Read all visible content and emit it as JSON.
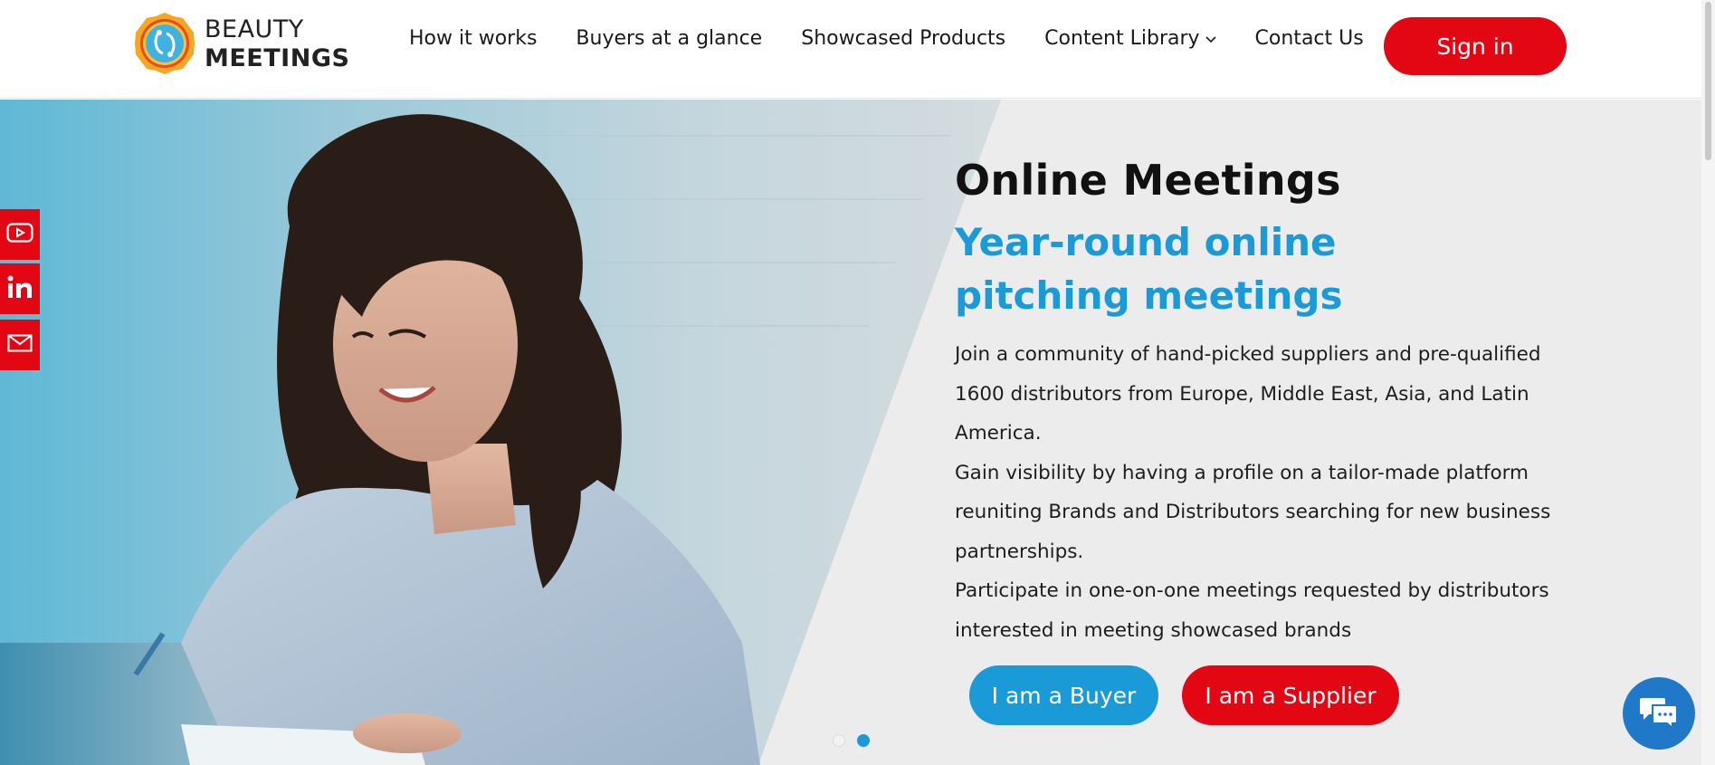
{
  "brand": {
    "line1": "BEAUTY",
    "line2": "MEETINGS"
  },
  "nav": {
    "items": [
      {
        "label": "How it works"
      },
      {
        "label": "Buyers at a glance"
      },
      {
        "label": "Showcased Products"
      },
      {
        "label": "Content Library",
        "icon": "chevron-down-icon"
      },
      {
        "label": "Contact Us"
      }
    ],
    "signin_label": "Sign in"
  },
  "hero": {
    "title": "Online Meetings",
    "subtitle": "Year-round online pitching meetings",
    "paragraphs": [
      "Join a community of hand-picked suppliers and pre-qualified 1600 distributors from Europe, Middle East, Asia, and Latin America.",
      "Gain visibility by having a profile on a tailor-made platform reuniting Brands and Distributors searching for new business partnerships.",
      "Participate in one-on-one meetings requested by distributors interested in meeting showcased brands"
    ],
    "buyer_label": "I am a Buyer",
    "supplier_label": "I am a Supplier",
    "slides": {
      "count": 2,
      "active": 2
    }
  },
  "social": [
    "youtube-icon",
    "linkedin-icon",
    "email-icon"
  ],
  "chat": {
    "icon": "chat-icon"
  },
  "colors": {
    "accent_red": "#e30613",
    "accent_blue": "#1a9ad6",
    "chat_blue": "#1f79c8",
    "hero_bg": "#ececec"
  }
}
